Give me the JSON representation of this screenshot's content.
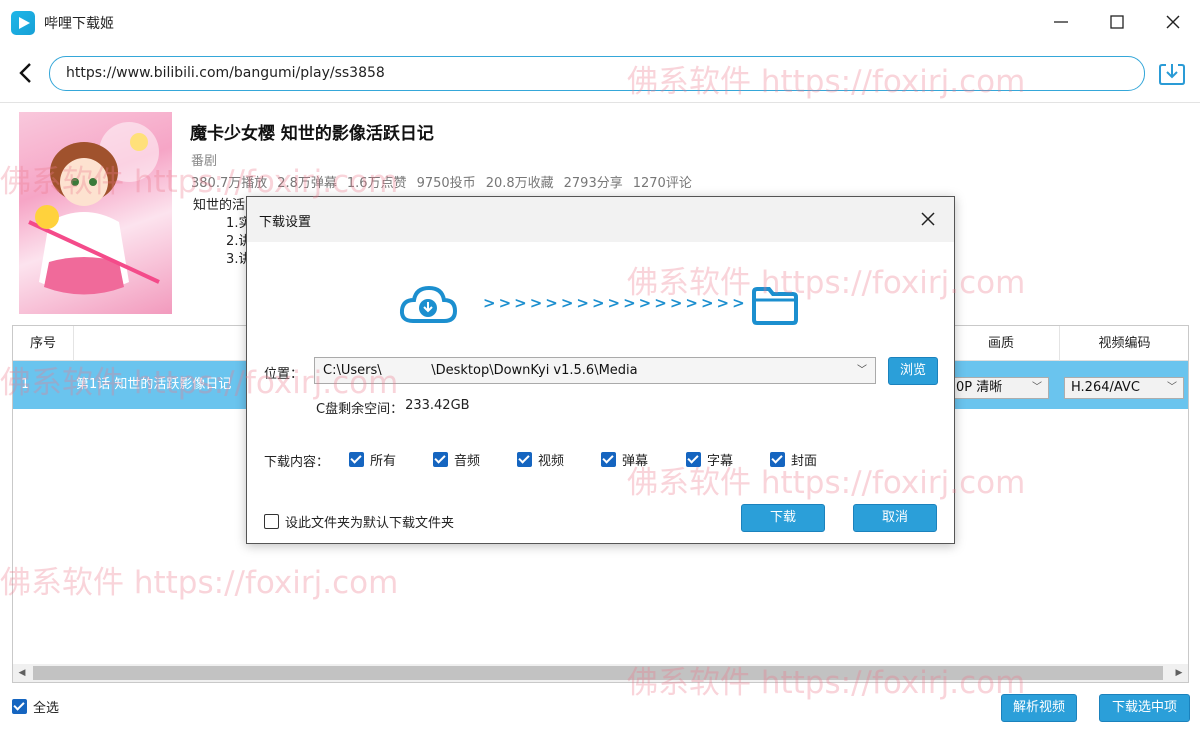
{
  "window": {
    "title": "哔哩下载姬"
  },
  "address": {
    "url": "https://www.bilibili.com/bangumi/play/ss3858"
  },
  "video": {
    "title": "魔卡少女樱 知世的影像活跃日记",
    "type": "番剧",
    "stats": [
      "380.7万播放",
      "2.8万弹幕",
      "1.6万点赞",
      "9750投币",
      "20.8万收藏",
      "2793分享",
      "1270评论"
    ],
    "description_lines": [
      "知世的活",
      "        1.实",
      "        2.讲",
      "        3.讲"
    ]
  },
  "table": {
    "headers": {
      "index": "序号",
      "quality": "画质",
      "codec": "视频编码"
    },
    "rows": [
      {
        "index": "1",
        "name": "第1话 知世的活跃影像日记",
        "quality": "0P 清晰",
        "codec": "H.264/AVC"
      }
    ]
  },
  "bottom": {
    "select_all": "全选",
    "parse_button": "解析视频",
    "download_selected_button": "下载选中项"
  },
  "dialog": {
    "title": "下载设置",
    "arrows": ">>>>>>>>>>>>>>>>>",
    "location_label": "位置：",
    "location_value": "C:\\Users\\            \\Desktop\\DownKyi v1.5.6\\Media",
    "browse_button": "浏览",
    "free_space_label": "C盘剩余空间：",
    "free_space_value": "233.42GB",
    "content_label": "下载内容：",
    "options": [
      {
        "label": "所有",
        "checked": true
      },
      {
        "label": "音频",
        "checked": true
      },
      {
        "label": "视频",
        "checked": true
      },
      {
        "label": "弹幕",
        "checked": true
      },
      {
        "label": "字幕",
        "checked": true
      },
      {
        "label": "封面",
        "checked": true
      }
    ],
    "set_default_label": "设此文件夹为默认下载文件夹",
    "set_default_checked": false,
    "download_button": "下载",
    "cancel_button": "取消"
  },
  "watermark": {
    "text": "佛系软件 https://foxirj.com"
  },
  "colors": {
    "accent": "#2b9fd9",
    "row_selected": "#6ac4ee",
    "checkbox": "#1565c0",
    "watermark": "#ec788c"
  }
}
